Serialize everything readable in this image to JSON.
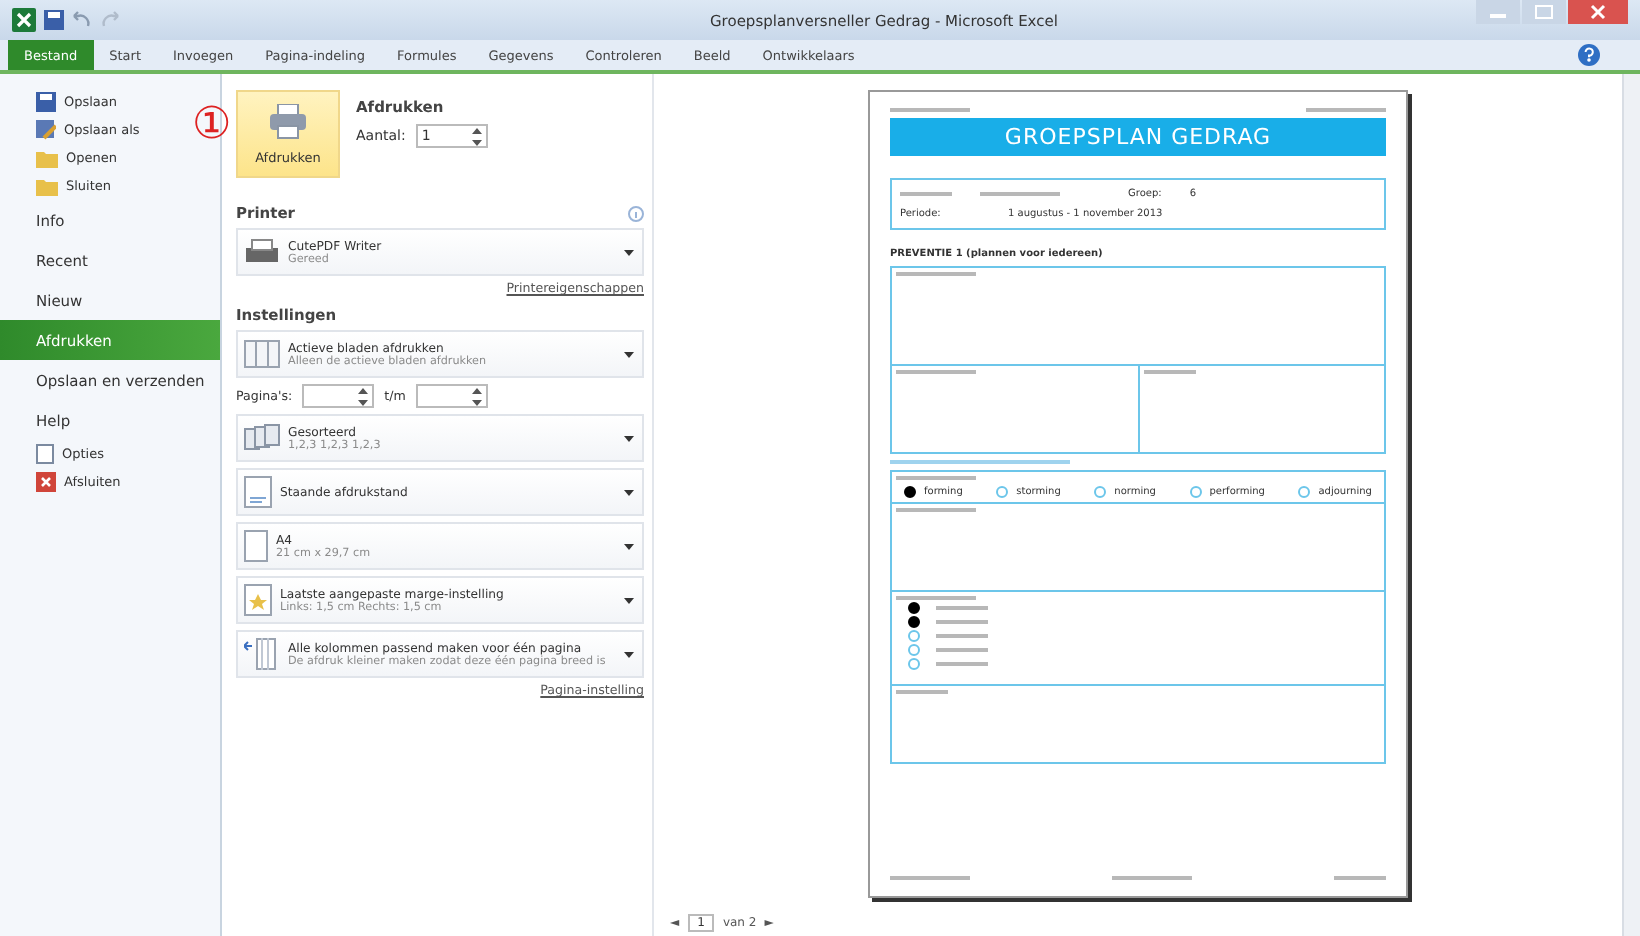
{
  "window": {
    "title": "Groepsplanversneller Gedrag - Microsoft Excel"
  },
  "tabs": [
    {
      "label": "Bestand",
      "selected": true
    },
    {
      "label": "Start",
      "selected": false
    },
    {
      "label": "Invoegen",
      "selected": false
    },
    {
      "label": "Pagina-indeling",
      "selected": false
    },
    {
      "label": "Formules",
      "selected": false
    },
    {
      "label": "Gegevens",
      "selected": false
    },
    {
      "label": "Controleren",
      "selected": false
    },
    {
      "label": "Beeld",
      "selected": false
    },
    {
      "label": "Ontwikkelaars",
      "selected": false
    }
  ],
  "nav": [
    {
      "label": "Opslaan",
      "kind": "small",
      "selected": false
    },
    {
      "label": "Opslaan als",
      "kind": "small",
      "selected": false
    },
    {
      "label": "Openen",
      "kind": "small",
      "selected": false
    },
    {
      "label": "Sluiten",
      "kind": "small",
      "selected": false
    },
    {
      "label": "Info",
      "kind": "large",
      "selected": false
    },
    {
      "label": "Recent",
      "kind": "large",
      "selected": false
    },
    {
      "label": "Nieuw",
      "kind": "large",
      "selected": false
    },
    {
      "label": "Afdrukken",
      "kind": "large",
      "selected": true
    },
    {
      "label": "Opslaan en verzenden",
      "kind": "large",
      "selected": false
    },
    {
      "label": "Help",
      "kind": "large",
      "selected": false
    },
    {
      "label": "Opties",
      "kind": "small",
      "selected": false
    },
    {
      "label": "Afsluiten",
      "kind": "small",
      "selected": false
    }
  ],
  "print": {
    "annotation": "①",
    "button_label": "Afdrukken",
    "heading": "Afdrukken",
    "copies_label": "Aantal:",
    "copies_value": "1"
  },
  "printer": {
    "heading": "Printer",
    "name": "CutePDF Writer",
    "status": "Gereed",
    "properties_link": "Printereigenschappen"
  },
  "settings": {
    "heading": "Instellingen",
    "pages_label": "Pagina's:",
    "to_label": "t/m",
    "setup_link": "Pagina-instelling",
    "options": [
      {
        "title": "Actieve bladen afdrukken",
        "subtitle": "Alleen de actieve bladen afdrukken"
      },
      {
        "title": "Gesorteerd",
        "subtitle": "1,2,3   1,2,3   1,2,3"
      },
      {
        "title": "Staande afdrukstand"
      },
      {
        "title": "A4",
        "subtitle": "21 cm x 29,7 cm"
      },
      {
        "title": "Laatste aangepaste marge-instelling",
        "subtitle": "Links: 1,5 cm   Rechts: 1,5 cm"
      },
      {
        "title": "Alle kolommen passend maken voor één pagina",
        "subtitle": "De afdruk kleiner maken zodat deze één pagina breed is"
      }
    ]
  },
  "preview": {
    "title": "GROEPSPLAN GEDRAG",
    "group_label": "Groep:",
    "group_value": "6",
    "period_label": "Periode:",
    "period_value": "1 augustus - 1 november 2013",
    "section": "PREVENTIE 1 (plannen voor iedereen)",
    "phases": [
      {
        "label": "forming",
        "selected": true
      },
      {
        "label": "storming",
        "selected": false
      },
      {
        "label": "norming",
        "selected": false
      },
      {
        "label": "performing",
        "selected": false
      },
      {
        "label": "adjourning",
        "selected": false
      }
    ],
    "checklist": [
      {
        "checked": true
      },
      {
        "checked": true
      },
      {
        "checked": false
      },
      {
        "checked": false
      },
      {
        "checked": false
      }
    ]
  },
  "pager": {
    "prev": "◄",
    "page": "1",
    "of": "van 2",
    "next": "►"
  }
}
